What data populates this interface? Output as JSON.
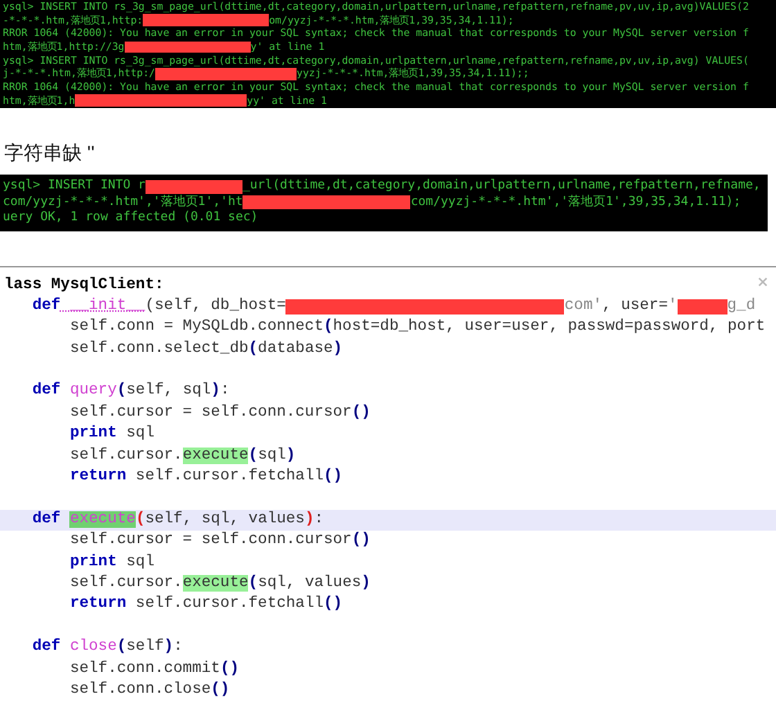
{
  "terminal_top": {
    "lines": [
      {
        "parts": [
          {
            "kind": "text",
            "text": "ysql> INSERT INTO rs_3g_sm_page_url(dttime,dt,category,domain,urlpattern,urlname,refpattern,refname,pv,uv,ip,avg)VALUES(2"
          }
        ]
      },
      {
        "parts": [
          {
            "kind": "text",
            "text": "-*-*-*.htm,落地页1,http:"
          },
          {
            "kind": "redaction"
          },
          {
            "kind": "text",
            "text": "om/yyzj-*-*-*.htm,落地页1,39,35,34,1.11);"
          }
        ]
      },
      {
        "parts": [
          {
            "kind": "text",
            "text": "RROR 1064 (42000): You have an error in your SQL syntax; check the manual that corresponds to your MySQL server version f"
          }
        ]
      },
      {
        "parts": [
          {
            "kind": "text",
            "text": "htm,落地页1,http://3g"
          },
          {
            "kind": "redaction"
          },
          {
            "kind": "text",
            "text": "y' at line 1"
          }
        ]
      },
      {
        "parts": [
          {
            "kind": "text",
            "text": "ysql> INSERT INTO rs_3g_sm_page_url(dttime,dt,category,domain,urlpattern,urlname,refpattern,refname,pv,uv,ip,avg) VALUES("
          }
        ]
      },
      {
        "parts": [
          {
            "kind": "text",
            "text": "j-*-*-*.htm,落地页1,http:/"
          },
          {
            "kind": "redaction"
          },
          {
            "kind": "text",
            "text": "yyzj-*-*-*.htm,落地页1,39,35,34,1.11);;"
          }
        ]
      },
      {
        "parts": [
          {
            "kind": "text",
            "text": "RROR 1064 (42000): You have an error in your SQL syntax; check the manual that corresponds to your MySQL server version f"
          }
        ]
      },
      {
        "parts": [
          {
            "kind": "text",
            "text": "htm,落地页1,h"
          },
          {
            "kind": "redaction"
          },
          {
            "kind": "text",
            "text": "yy' at line 1"
          }
        ]
      }
    ]
  },
  "caption": "字符串缺 ''",
  "terminal_bottom": {
    "lines": [
      {
        "parts": [
          {
            "kind": "text",
            "text": "ysql> INSERT INTO r"
          },
          {
            "kind": "redaction"
          },
          {
            "kind": "text",
            "text": "_url(dttime,dt,category,domain,urlpattern,urlname,refpattern,refname,"
          }
        ]
      },
      {
        "parts": [
          {
            "kind": "text",
            "text": "com/yyzj-*-*-*.htm','落地页1','ht"
          },
          {
            "kind": "redaction"
          },
          {
            "kind": "text",
            "text": "com/yyzj-*-*-*.htm','落地页1',39,35,34,1.11);"
          }
        ]
      },
      {
        "parts": [
          {
            "kind": "text",
            "text": "uery OK, 1 row affected (0.01 sec)"
          }
        ]
      }
    ]
  },
  "editor": {
    "lines": [
      {
        "current": false,
        "parts": [
          {
            "kind": "code",
            "tokens": [
              {
                "kind": "cls",
                "s": "lass MysqlClient:"
              }
            ]
          }
        ]
      },
      {
        "current": false,
        "parts": [
          {
            "kind": "code",
            "tokens": [
              {
                "kind": "kw",
                "s": "   def"
              },
              {
                "kind": "magic",
                "s": " __init__"
              },
              {
                "kind": "plain",
                "s": "(self, db_host="
              }
            ]
          },
          {
            "kind": "redaction"
          },
          {
            "kind": "code",
            "tokens": [
              {
                "kind": "str",
                "s": "com'"
              },
              {
                "kind": "plain",
                "s": ", user="
              },
              {
                "kind": "str",
                "s": "'"
              }
            ]
          },
          {
            "kind": "redaction"
          },
          {
            "kind": "code",
            "tokens": [
              {
                "kind": "str",
                "s": "g_d"
              }
            ]
          }
        ]
      },
      {
        "current": false,
        "parts": [
          {
            "kind": "code",
            "tokens": [
              {
                "kind": "plain",
                "s": "       self.conn = MySQLdb.connect"
              },
              {
                "kind": "paren",
                "s": "("
              },
              {
                "kind": "plain",
                "s": "host=db_host, user=user, passwd=password, port"
              }
            ]
          }
        ]
      },
      {
        "current": false,
        "parts": [
          {
            "kind": "code",
            "tokens": [
              {
                "kind": "plain",
                "s": "       self.conn.select_db"
              },
              {
                "kind": "paren",
                "s": "("
              },
              {
                "kind": "plain",
                "s": "database"
              },
              {
                "kind": "paren",
                "s": ")"
              }
            ]
          }
        ]
      },
      {
        "current": false
      },
      {
        "current": false,
        "parts": [
          {
            "kind": "code",
            "tokens": [
              {
                "kind": "kw",
                "s": "   def"
              },
              {
                "kind": "fn",
                "s": " query"
              },
              {
                "kind": "paren",
                "s": "("
              },
              {
                "kind": "plain",
                "s": "self, sql"
              },
              {
                "kind": "paren",
                "s": ")"
              },
              {
                "kind": "plain",
                "s": ":"
              }
            ]
          }
        ]
      },
      {
        "current": false,
        "parts": [
          {
            "kind": "code",
            "tokens": [
              {
                "kind": "plain",
                "s": "       self.cursor = self.conn.cursor"
              },
              {
                "kind": "paren",
                "s": "()"
              }
            ]
          }
        ]
      },
      {
        "current": false,
        "parts": [
          {
            "kind": "code",
            "tokens": [
              {
                "kind": "kw",
                "s": "       print"
              },
              {
                "kind": "plain",
                "s": " sql"
              }
            ]
          }
        ]
      },
      {
        "current": false,
        "parts": [
          {
            "kind": "code",
            "tokens": [
              {
                "kind": "plain",
                "s": "       self.cursor."
              },
              {
                "kind": "hl",
                "s": "execute"
              },
              {
                "kind": "paren",
                "s": "("
              },
              {
                "kind": "plain",
                "s": "sql"
              },
              {
                "kind": "paren",
                "s": ")"
              }
            ]
          }
        ]
      },
      {
        "current": false,
        "parts": [
          {
            "kind": "code",
            "tokens": [
              {
                "kind": "kw",
                "s": "       return"
              },
              {
                "kind": "plain",
                "s": " self.cursor.fetchall"
              },
              {
                "kind": "paren",
                "s": "()"
              }
            ]
          }
        ]
      },
      {
        "current": false
      },
      {
        "current": true,
        "parts": [
          {
            "kind": "code",
            "tokens": [
              {
                "kind": "kw",
                "s": "   def "
              },
              {
                "kind": "fnhl",
                "s": "execute"
              },
              {
                "kind": "err",
                "s": "("
              },
              {
                "kind": "plain",
                "s": "self, sql, values"
              },
              {
                "kind": "err",
                "s": ")"
              },
              {
                "kind": "plain",
                "s": ":"
              }
            ]
          }
        ]
      },
      {
        "current": false,
        "parts": [
          {
            "kind": "code",
            "tokens": [
              {
                "kind": "plain",
                "s": "       self.cursor = self.conn.cursor"
              },
              {
                "kind": "paren",
                "s": "()"
              }
            ]
          }
        ]
      },
      {
        "current": false,
        "parts": [
          {
            "kind": "code",
            "tokens": [
              {
                "kind": "kw",
                "s": "       print"
              },
              {
                "kind": "plain",
                "s": " sql"
              }
            ]
          }
        ]
      },
      {
        "current": false,
        "parts": [
          {
            "kind": "code",
            "tokens": [
              {
                "kind": "plain",
                "s": "       self.cursor."
              },
              {
                "kind": "hl",
                "s": "execute"
              },
              {
                "kind": "paren",
                "s": "("
              },
              {
                "kind": "plain",
                "s": "sql, values"
              },
              {
                "kind": "paren",
                "s": ")"
              }
            ]
          }
        ]
      },
      {
        "current": false,
        "parts": [
          {
            "kind": "code",
            "tokens": [
              {
                "kind": "kw",
                "s": "       return"
              },
              {
                "kind": "plain",
                "s": " self.cursor.fetchall"
              },
              {
                "kind": "paren",
                "s": "()"
              }
            ]
          }
        ]
      },
      {
        "current": false
      },
      {
        "current": false,
        "parts": [
          {
            "kind": "code",
            "tokens": [
              {
                "kind": "kw",
                "s": "   def"
              },
              {
                "kind": "fn",
                "s": " close"
              },
              {
                "kind": "paren",
                "s": "("
              },
              {
                "kind": "plain",
                "s": "self"
              },
              {
                "kind": "paren",
                "s": ")"
              },
              {
                "kind": "plain",
                "s": ":"
              }
            ]
          }
        ]
      },
      {
        "current": false,
        "parts": [
          {
            "kind": "code",
            "tokens": [
              {
                "kind": "plain",
                "s": "       self.conn.commit"
              },
              {
                "kind": "paren",
                "s": "()"
              }
            ]
          }
        ]
      },
      {
        "current": false,
        "parts": [
          {
            "kind": "code",
            "tokens": [
              {
                "kind": "plain",
                "s": "       self.conn.close"
              },
              {
                "kind": "paren",
                "s": "()"
              }
            ]
          }
        ]
      }
    ]
  }
}
